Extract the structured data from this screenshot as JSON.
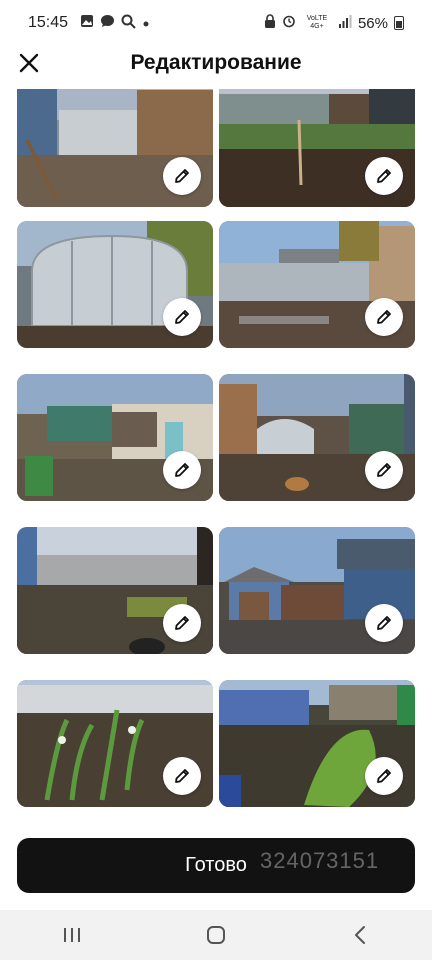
{
  "status_bar": {
    "time": "15:45",
    "network": "VoLTE 4G+",
    "battery": "56%",
    "icons": [
      "gallery-icon",
      "chat-icon",
      "search-icon",
      "dot-icon",
      "lock-icon",
      "alarm-icon",
      "signal-icon",
      "battery-icon"
    ]
  },
  "header": {
    "title": "Редактирование",
    "close_icon": "close-icon"
  },
  "photos": [
    {
      "name": "photo-1",
      "edit_icon": "pencil-icon"
    },
    {
      "name": "photo-2",
      "edit_icon": "pencil-icon"
    },
    {
      "name": "photo-3",
      "edit_icon": "pencil-icon"
    },
    {
      "name": "photo-4",
      "edit_icon": "pencil-icon"
    },
    {
      "name": "photo-5",
      "edit_icon": "pencil-icon"
    },
    {
      "name": "photo-6",
      "edit_icon": "pencil-icon"
    },
    {
      "name": "photo-7",
      "edit_icon": "pencil-icon"
    },
    {
      "name": "photo-8",
      "edit_icon": "pencil-icon"
    },
    {
      "name": "photo-9",
      "edit_icon": "pencil-icon"
    },
    {
      "name": "photo-10",
      "edit_icon": "pencil-icon"
    }
  ],
  "done_button": {
    "label": "Готово"
  },
  "watermark": {
    "text": "324073151"
  },
  "nav_bar": {
    "icons": [
      "recent-apps-icon",
      "home-icon",
      "back-icon"
    ]
  },
  "colors": {
    "button_bg": "#121212",
    "button_text": "#ffffff",
    "nav_bg": "#f2f2f2"
  }
}
